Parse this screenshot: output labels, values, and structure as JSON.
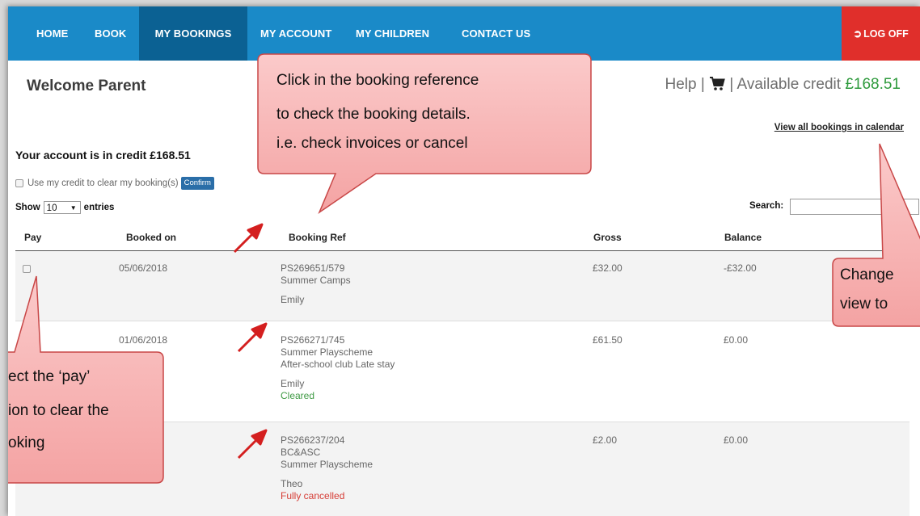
{
  "nav": {
    "items": [
      {
        "label": "HOME"
      },
      {
        "label": "BOOK"
      },
      {
        "label": "MY BOOKINGS"
      },
      {
        "label": "MY ACCOUNT"
      },
      {
        "label": "MY CHILDREN"
      },
      {
        "label": "CONTACT US"
      }
    ],
    "logoff": "LOG OFF"
  },
  "header": {
    "welcome": "Welcome Parent",
    "help": "Help |",
    "sep": "|",
    "credit_label": "Available credit",
    "credit_value": "£168.51",
    "view_all": "View all bookings in calendar"
  },
  "account": {
    "credit_title": "Your account is in credit £168.51",
    "use_credit": "Use my credit to clear my booking(s)",
    "confirm": "Confirm",
    "show": "Show",
    "entries_value": "10",
    "entries": "entries",
    "search": "Search:"
  },
  "table": {
    "headers": [
      "Pay",
      "Booked on",
      "Booking Ref",
      "Gross",
      "Balance"
    ],
    "rows": [
      {
        "booked_on": "05/06/2018",
        "ref": "PS269651/579",
        "lines": [
          "Summer Camps"
        ],
        "child": "Emily",
        "status": "",
        "gross": "£32.00",
        "balance": "-£32.00"
      },
      {
        "booked_on": "01/06/2018",
        "ref": "PS266271/745",
        "lines": [
          "Summer Playscheme",
          "After-school club Late stay"
        ],
        "child": "Emily",
        "status": "Cleared",
        "gross": "£61.50",
        "balance": "£0.00"
      },
      {
        "booked_on": "",
        "ref": "PS266237/204",
        "lines": [
          "BC&ASC",
          "Summer Playscheme"
        ],
        "child": "Theo",
        "status": "Fully cancelled",
        "gross": "£2.00",
        "balance": "£0.00"
      }
    ]
  },
  "callouts": {
    "booking_ref": [
      "Click in the booking reference",
      "to check the booking details.",
      "i.e. check invoices or cancel"
    ],
    "pay": [
      "ect the ‘pay’",
      "ion to clear the",
      "oking"
    ],
    "calendar": [
      "Change",
      "view to"
    ]
  },
  "colors": {
    "nav_bg": "#1a8ac8",
    "nav_active": "#0b6193",
    "logoff_bg": "#e02f2b",
    "credit_green": "#2e9a3c",
    "callout_fill": "#f8b2b2",
    "callout_stroke": "#c84747",
    "pointer_red": "#d41f1f"
  }
}
